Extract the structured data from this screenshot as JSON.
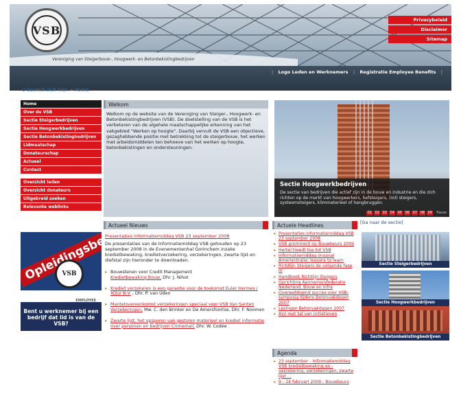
{
  "header": {
    "logo_text": "VSB",
    "tagline": "Vereniging van Steigerbouw-, Hoogwerk- en Betonbekistingbedrijven",
    "toplinks": [
      "Privacybeleid",
      "Disclaimer",
      "Sitemap"
    ]
  },
  "band": {
    "links": [
      "Logo Leden en Werknemers",
      "Registratie Employee Benefits"
    ]
  },
  "breadcrumb": {
    "prefix": "U bevindt zich hier:",
    "sep": "»",
    "current": "Home"
  },
  "nav": {
    "group1": [
      "Home",
      "Over de VSB",
      "Sectie Steigerbedrijven",
      "Sectie Hoogwerkbedrijven",
      "Sectie Betonbekistingbedrijven",
      "Lidmaatschap",
      "Donateurschap",
      "Actueel",
      "Contact"
    ],
    "group2": [
      "Overzicht leden",
      "Overzicht donateurs",
      "Uitgebreid zoeken",
      "Relevante weblinks"
    ]
  },
  "welcome": {
    "heading": "Welkom",
    "text": "Welkom op de website van de Vereniging van Steiger-, Hoogwerk- en Betonbekistingbedrijven (VSB). De doelstelling van de VSB is het verbeteren van de algehele maatschappelijke erkenning van het vakgebied \"Werken op hoogte\". Daarbij vervult de VSB een objectieve, gezaghebbende positie met betrekking tot de steigerbouw, het werken met arbeidsmiddelen ten behoeve van het werken op hoogte, betonbekistingen en ondersteuningen."
  },
  "slide": {
    "title": "Sectie Hoogwerkbedrijven",
    "desc": "De sectie van bedrijven die actief zijn in de bouw en industrie en die zich richten op de markt van hoogwerkers, hefsteigers, (rol) steigers, systeemsteigers, klimmaterieel of hangbruggen.",
    "pages": [
      "01",
      "02",
      "03",
      "04",
      "05",
      "06",
      "07",
      "08",
      "09"
    ],
    "pause": "Pause"
  },
  "section_link": "[Ga naar de sectie]",
  "badge1": {
    "text": "Opleidingsbedrijf",
    "seal": "VSB"
  },
  "badge2": {
    "employer": "EMPLOYEE",
    "text": "Bent u werknemer bij een bedrijf dat lid is van de VSB?"
  },
  "news": {
    "heading": "Actueel Nieuws",
    "lead_title": "Presentaties Informatiemiddag VSB 23 september 2008",
    "lead_body": "De presentaties van de Informatiemiddag VSB gehouden op 23 september 2008 in de Evenementenhal Gorinchem inzake kredietbewaking, kredietverzekering, verzekeringen, zwarte lijst en diefstal zijn hieronder te downloaden.",
    "items": [
      {
        "pre": "Bouwstenen voor Credit Management",
        "link": "Kredietbewaking Bouw,",
        "post": " Dhr. J. Nihot"
      },
      {
        "pre": "",
        "link": "Krediet verzekeren is een garantie voor de toekomst Euler Hermes / XOLV B.V.",
        "post": " , Dhr. P. van Uden"
      },
      {
        "pre": "",
        "link": "Mantelovereenkomst verzekeringen speciaal voor VSB Van Santen Verzekeringen,",
        "post": " Mw. C. den Brinker en De Amersfoortse, Dhr. F. Noomen"
      },
      {
        "pre": "",
        "link": "Zwarte lijst, het opsporen van gestolen materieel en krediet informatie over personen en bedrijven Crimemail,",
        "post": " Dhr. W. Codée"
      }
    ]
  },
  "headlines": {
    "heading": "Actuele Headlines",
    "items": [
      "Presentaties Informatiemiddag VSB 23 september 2008",
      "VSB prominent op Bouwbeurs 2009",
      "Hertel treedt toe tot VSB",
      "Informatiemiddag onsaval Amerientralie: lessons to learn",
      "Richtlijn Steigers de volgende fase in",
      "Handboek Richtlijn Steigers",
      "Oprichting Aannemersfederatie Nederland, Bouw en Infra",
      "Overweldigend succes voor VSB-symposia tijdens Betonvakdagen 2007",
      "Lezingen Betonvakdagen 2007",
      "ALV met tal van initiatieven"
    ]
  },
  "agenda": {
    "heading": "Agenda",
    "items": [
      "23 september - Informatiemiddag VSB kredietbewaking en -verzekering, verzekeringen, zwarte lijst ...",
      "9 - 14 februari 2009 - Bouwbeurs"
    ]
  },
  "thumbs": [
    "Sectie Steigerbedrijven",
    "Sectie Hoogwerkbedrijven",
    "Sectie Betonbekistingbedrijven"
  ],
  "colors": {
    "brand_red": "#d9151b",
    "navy": "#1d2f5a",
    "band": "#2a3845"
  }
}
